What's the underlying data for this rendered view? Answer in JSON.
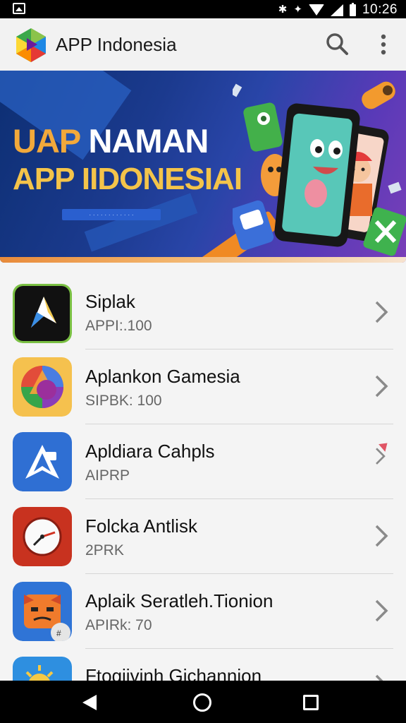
{
  "status_bar": {
    "time": "10:26",
    "icons": [
      "gallery-icon",
      "bluetooth-icon",
      "vibrate-icon",
      "wifi-icon",
      "signal-icon",
      "battery-icon"
    ]
  },
  "app_bar": {
    "title": "APP Indonesia",
    "icons": [
      "app-logo-icon",
      "search-icon",
      "more-vert-icon"
    ]
  },
  "banner": {
    "line1_part1": "UAP",
    "line1_part2": "NAMAN",
    "line2": "APP IIDONESIAI",
    "pill_text": "· · · · · · · · · · · ·"
  },
  "apps": [
    {
      "name": "Siplak",
      "sub": "APPI:.100"
    },
    {
      "name": "Aplankon Gamesia",
      "sub": "SIPBK: 100"
    },
    {
      "name": "Apldiara Cahpls",
      "sub": "AIPRP"
    },
    {
      "name": "Folcka Antlisk",
      "sub": "2PRK"
    },
    {
      "name": "Aplaik Seratleh.Tionion",
      "sub": "APIRk: 70"
    },
    {
      "name": "Ftogiivinh Gichannion",
      "sub": ""
    }
  ],
  "colors": {
    "accent_orange": "#f08a24",
    "banner_blue": "#1b3a8e",
    "banner_purple": "#7a3fb8"
  }
}
